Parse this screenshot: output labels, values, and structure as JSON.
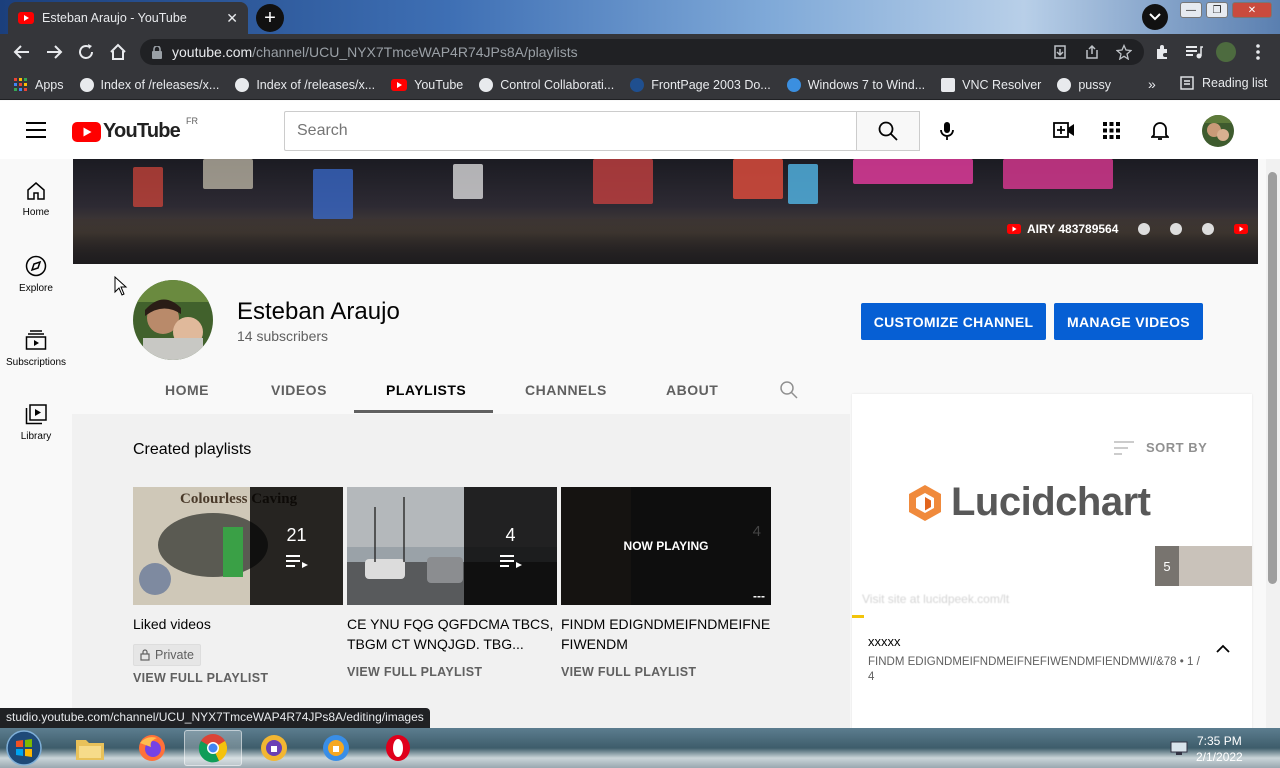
{
  "browser": {
    "tab_title": "Esteban Araujo - YouTube",
    "url_host": "youtube.com",
    "url_path": "/channel/UCU_NYX7TmceWAP4R74JPs8A/playlists",
    "bookmarks": [
      {
        "label": "Apps",
        "icon": "apps-grid-icon"
      },
      {
        "label": "Index of /releases/x...",
        "icon": "globe-icon"
      },
      {
        "label": "Index of /releases/x...",
        "icon": "globe-icon"
      },
      {
        "label": "YouTube",
        "icon": "youtube-icon"
      },
      {
        "label": "Control Collaborati...",
        "icon": "globe-icon"
      },
      {
        "label": "FrontPage 2003 Do...",
        "icon": "page-icon"
      },
      {
        "label": "Windows 7 to Wind...",
        "icon": "edge-icon"
      },
      {
        "label": "VNC Resolver",
        "icon": "vnc-icon"
      },
      {
        "label": "pussy",
        "icon": "globe-icon"
      }
    ],
    "bookmarks_more": "»",
    "reading_list": "Reading list",
    "status_url": "studio.youtube.com/channel/UCU_NYX7TmceWAP4R74JPs8A/editing/images"
  },
  "masthead": {
    "logo_text": "YouTube",
    "region": "FR",
    "search_placeholder": "Search"
  },
  "sidenav": [
    {
      "label": "Home",
      "icon": "home-icon"
    },
    {
      "label": "Explore",
      "icon": "compass-icon"
    },
    {
      "label": "Subscriptions",
      "icon": "subscriptions-icon"
    },
    {
      "label": "Library",
      "icon": "library-icon"
    }
  ],
  "banner": {
    "link_label": "AIRY 483789564"
  },
  "channel": {
    "name": "Esteban Araujo",
    "subscribers": "14 subscribers",
    "customize_label": "CUSTOMIZE CHANNEL",
    "manage_label": "MANAGE VIDEOS",
    "tabs": [
      "HOME",
      "VIDEOS",
      "PLAYLISTS",
      "CHANNELS",
      "ABOUT"
    ],
    "active_tab": "PLAYLISTS"
  },
  "playlists": {
    "section_title": "Created playlists",
    "items": [
      {
        "title": "Liked videos",
        "count": "21",
        "privacy": "Private",
        "action": "VIEW FULL PLAYLIST",
        "thumb_text": "Colourless Caving"
      },
      {
        "title": "CE YNU FQG QGFDCMA TBCS, TBGM CT WNQJGD. TBG...",
        "count": "4",
        "action": "VIEW FULL PLAYLIST"
      },
      {
        "title": "FINDM EDIGNDMEIFNDMEIFNEFIWENDM",
        "count": "4",
        "hover_label": "NOW PLAYING",
        "duration": "---",
        "action": "VIEW FULL PLAYLIST"
      }
    ]
  },
  "panel": {
    "sort_label": "SORT BY",
    "ad_brand": "Lucidchart",
    "ad_count": "5",
    "ad_faded": "Visit site at lucidpeek.com/lt",
    "item_title": "xxxxx",
    "item_meta": "FINDM EDIGNDMEIFNDMEIFNEFIWENDMFIENDMWI/&78 • 1 / 4"
  },
  "taskbar": {
    "time": "7:35 PM",
    "date": "2/1/2022"
  },
  "colors": {
    "yt_red": "#ff0000",
    "button_blue": "#065fd4",
    "chrome_dark": "#35363a"
  }
}
